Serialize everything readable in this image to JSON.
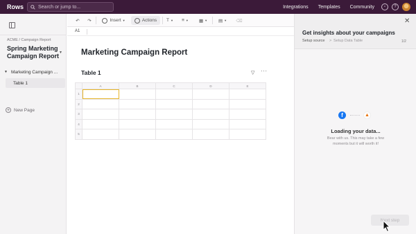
{
  "topbar": {
    "logo": "Rows",
    "search_placeholder": "Search or jump to...",
    "links": [
      "Integrations",
      "Templates",
      "Community"
    ],
    "icons": [
      "gift-icon",
      "help-icon",
      "avatar"
    ],
    "bg_color": "#3b1a39"
  },
  "sidebar": {
    "breadcrumb": "ACME / Campaign Report",
    "doc_title": "Spring Marketing Campaign Report",
    "page": "Marketing Campaign ...",
    "table": "Table 1",
    "new_page": "New Page"
  },
  "toolbar": {
    "insert_label": "Insert",
    "actions_label": "Actions",
    "cell_ref": "A1"
  },
  "main": {
    "report_title": "Marketing Campaign Report",
    "table_title": "Table 1",
    "columns": [
      "A",
      "B",
      "C",
      "D",
      "E"
    ],
    "rows": [
      "1",
      "2",
      "3",
      "4",
      "5"
    ]
  },
  "panel": {
    "title": "Get insights about your campaigns",
    "step1": "Setup source",
    "step_sep": ">",
    "step2": "Setup Data Table",
    "counter": "1/2",
    "loading": "Loading your data...",
    "loading_sub": "Bear with us. This may take a few moments but it will worth it!",
    "next_button": "Next step",
    "accent_blue": "#1877f2",
    "accent_orange": "#e8710a"
  }
}
